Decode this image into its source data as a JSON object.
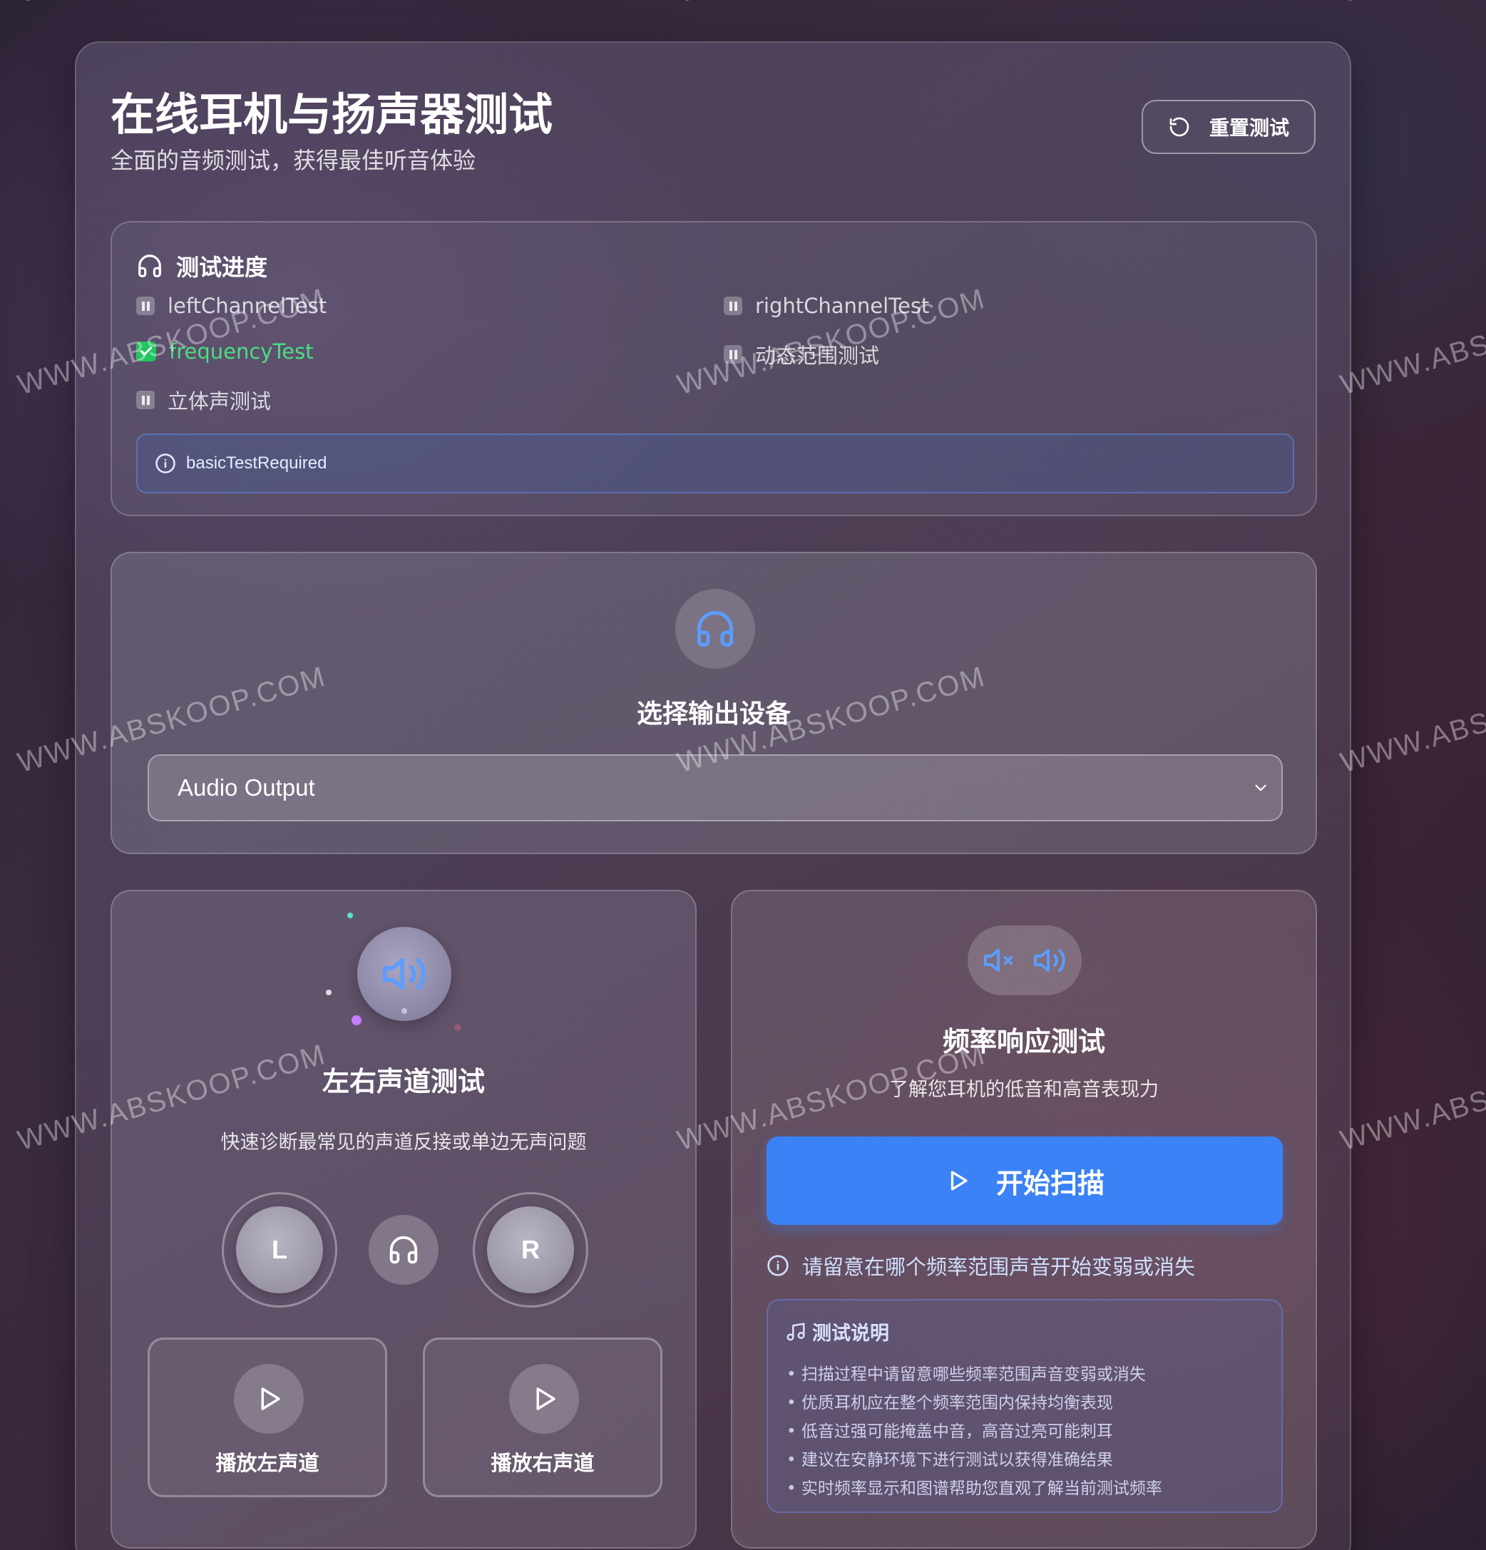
{
  "header": {
    "title": "在线耳机与扬声器测试",
    "subtitle": "全面的音频测试，获得最佳听音体验",
    "reset_label": "重置测试"
  },
  "progress": {
    "title": "测试进度",
    "items": [
      {
        "label": "leftChannelTest",
        "status": "pending"
      },
      {
        "label": "rightChannelTest",
        "status": "pending"
      },
      {
        "label": "frequencyTest",
        "status": "done"
      },
      {
        "label": "动态范围测试",
        "status": "pending"
      },
      {
        "label": "立体声测试",
        "status": "pending"
      }
    ],
    "info": "basicTestRequired"
  },
  "device": {
    "title": "选择输出设备",
    "selected": "Audio Output"
  },
  "channel_test": {
    "title": "左右声道测试",
    "description": "快速诊断最常见的声道反接或单边无声问题",
    "left_label": "L",
    "right_label": "R",
    "play_left": "播放左声道",
    "play_right": "播放右声道"
  },
  "frequency_test": {
    "title": "频率响应测试",
    "description": "了解您耳机的低音和高音表现力",
    "scan_label": "开始扫描",
    "hint": "请留意在哪个频率范围声音开始变弱或消失",
    "notes_title": "测试说明",
    "notes": [
      "扫描过程中请留意哪些频率范围声音变弱或消失",
      "优质耳机应在整个频率范围内保持均衡表现",
      "低音过强可能掩盖中音，高音过亮可能刺耳",
      "建议在安静环境下进行测试以获得准确结果",
      "实时频率显示和图谱帮助您直观了解当前测试频率"
    ]
  },
  "watermark": "WWW.ABSKOOP.COM",
  "colors": {
    "accent": "#3b82f6",
    "success": "#22c55e",
    "device_icon": "#5b9dff"
  }
}
